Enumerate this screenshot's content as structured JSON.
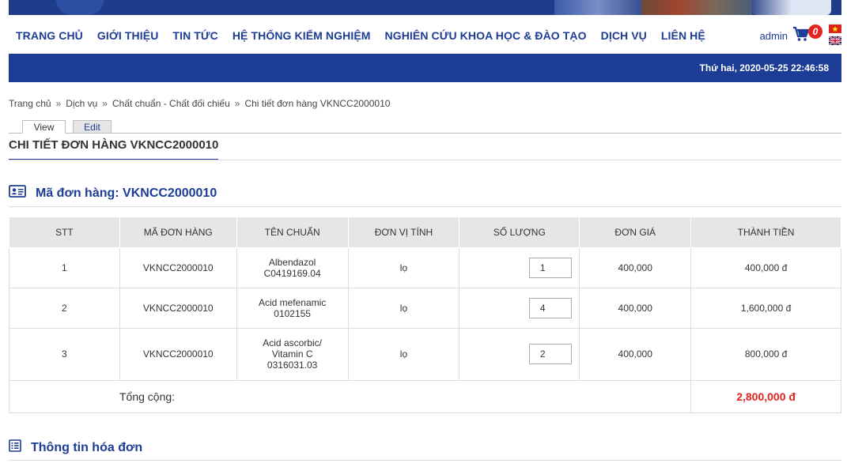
{
  "nav": {
    "items": [
      "TRANG CHỦ",
      "GIỚI THIỆU",
      "TIN TỨC",
      "HỆ THỐNG KIỂM NGHIỆM",
      "NGHIÊN CỨU KHOA HỌC & ĐÀO TẠO",
      "DỊCH VỤ",
      "LIÊN HỆ"
    ],
    "user": "admin",
    "cart_count": "0"
  },
  "datebar": {
    "datetime": "Thứ hai, 2020-05-25 22:46:58"
  },
  "breadcrumb": [
    "Trang chủ",
    "Dịch vụ",
    "Chất chuẩn - Chất đối chiếu",
    "Chi tiết đơn hàng VKNCC2000010"
  ],
  "breadcrumb_sep": "»",
  "tabs": {
    "view": "View",
    "edit": "Edit"
  },
  "page_title": "CHI TIẾT ĐƠN HÀNG VKNCC2000010",
  "order_section": {
    "heading": "Mã đơn hàng: VKNCC2000010"
  },
  "table": {
    "headers": [
      "STT",
      "MÃ ĐƠN HÀNG",
      "TÊN CHUẨN",
      "ĐƠN VỊ TÍNH",
      "SỐ LƯỢNG",
      "ĐƠN GIÁ",
      "THÀNH TIỀN"
    ],
    "rows": [
      {
        "stt": "1",
        "code": "VKNCC2000010",
        "name_lines": [
          "Albendazol",
          "C0419169.04"
        ],
        "unit": "lọ",
        "qty": "1",
        "price": "400,000",
        "amount": "400,000 đ"
      },
      {
        "stt": "2",
        "code": "VKNCC2000010",
        "name_lines": [
          "Acid mefenamic",
          "0102155"
        ],
        "unit": "lọ",
        "qty": "4",
        "price": "400,000",
        "amount": "1,600,000 đ"
      },
      {
        "stt": "3",
        "code": "VKNCC2000010",
        "name_lines": [
          "Acid ascorbic/",
          "Vitamin C",
          "0316031.03"
        ],
        "unit": "lọ",
        "qty": "2",
        "price": "400,000",
        "amount": "800,000 đ"
      }
    ],
    "total_label": "Tổng cộng:",
    "total_value": "2,800,000 đ"
  },
  "invoice_section": {
    "heading": "Thông tin hóa đơn"
  },
  "colors": {
    "brand_blue": "#1d3c95",
    "accent_red": "#e52420",
    "header_gray": "#e6e6e6"
  }
}
